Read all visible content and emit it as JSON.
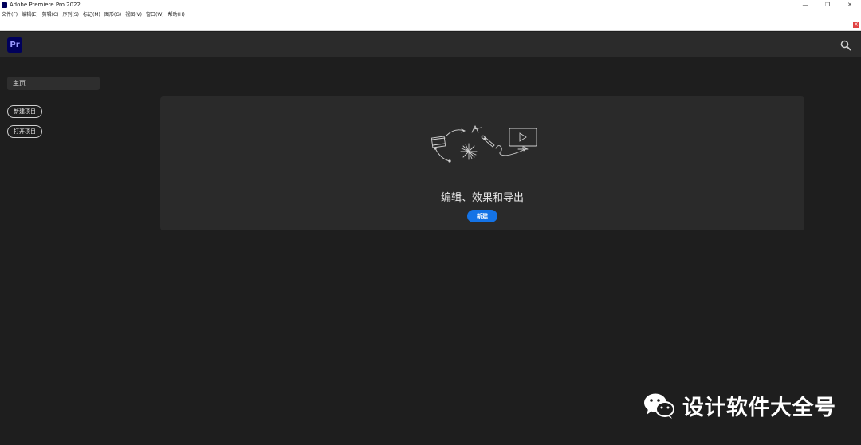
{
  "window": {
    "title": "Adobe Premiere Pro 2022",
    "controls": [
      "—",
      "❐",
      "✕"
    ]
  },
  "menubar": {
    "items": [
      "文件(F)",
      "编辑(E)",
      "剪辑(C)",
      "序列(S)",
      "标记(M)",
      "图形(G)",
      "视图(V)",
      "窗口(W)",
      "帮助(H)"
    ]
  },
  "notice": {
    "close_label": "×"
  },
  "header": {
    "logo_text": "Pr",
    "search_icon": "search-icon"
  },
  "sidebar": {
    "home_label": "主页",
    "new_project_label": "新建项目",
    "open_project_label": "打开项目"
  },
  "main": {
    "heading": "编辑、效果和导出",
    "new_button_label": "新建"
  },
  "watermark": {
    "text": "设计软件大全号",
    "icon": "wechat-icon"
  },
  "colors": {
    "accent": "#1473e6",
    "logo_bg": "#00005b",
    "logo_fg": "#9999ff",
    "background": "#1e1e1e",
    "card": "#2a2a2a"
  }
}
